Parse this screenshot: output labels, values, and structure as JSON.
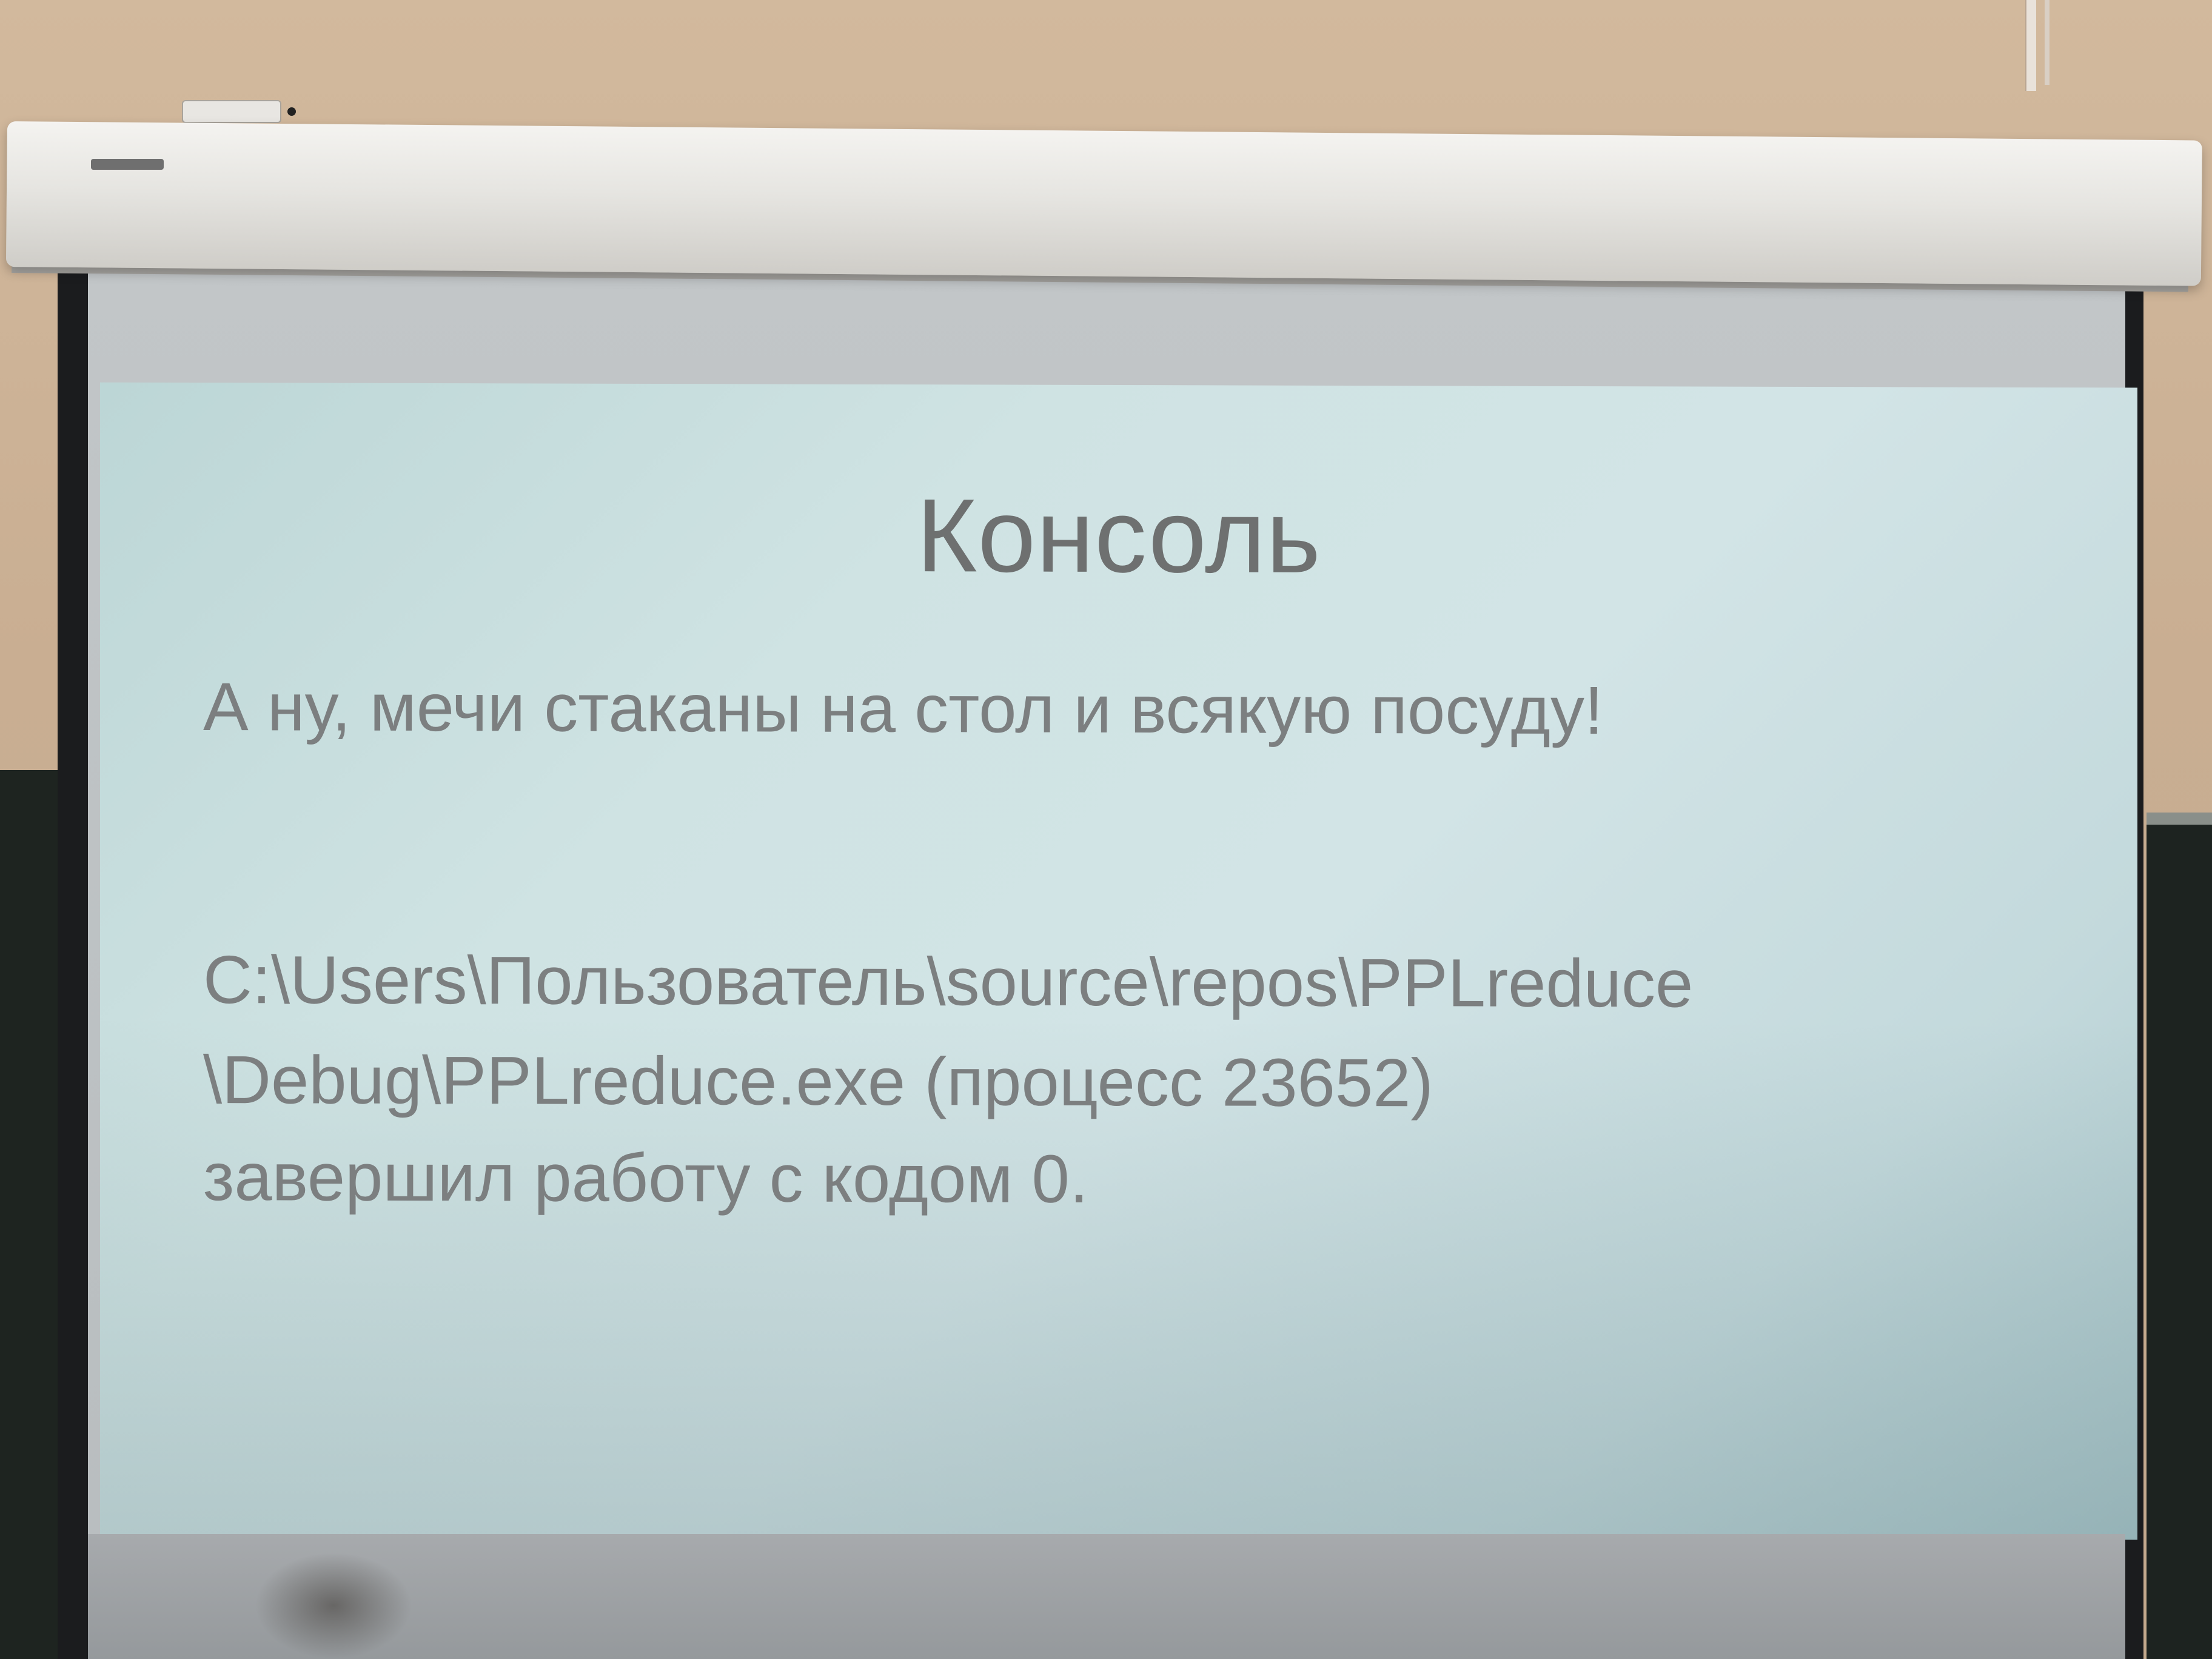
{
  "slide": {
    "title": "Консоль",
    "lines": [
      "А ну, мечи стаканы на стол и всякую посуду!",
      "C:\\Users\\Пользователь\\source\\repos\\PPLreduce",
      "\\Debug\\PPLreduce.exe (процесс 23652)",
      "завершил работу с кодом 0."
    ]
  },
  "colors": {
    "slide_background": "#cfe3e3",
    "slide_text": "#7c7f80",
    "wall": "#cdb49a",
    "screen_frame": "#1b1c1e"
  }
}
